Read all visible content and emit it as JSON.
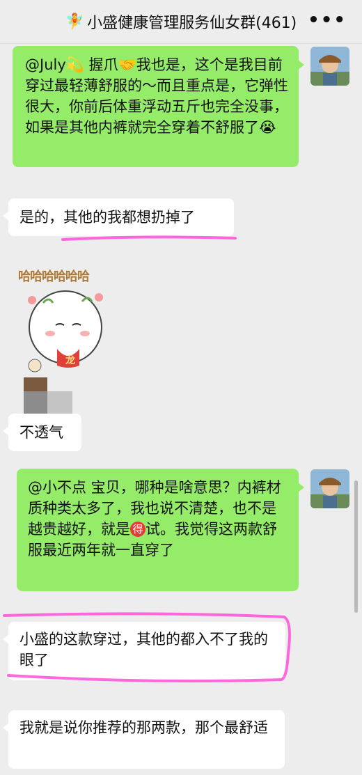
{
  "header": {
    "title": "小盛健康管理服务仙女群(461)",
    "fairy_icon": "fairy-emoji-icon",
    "more_label": "•••"
  },
  "messages": [
    {
      "side": "right",
      "mention": "@July",
      "text_a": " 握爪",
      "text_b": "我也是，这个是我目前穿过最轻薄舒服的～而且重点是，它弹性很大，你前后体重浮动五斤也完全没事，如果是其他内裤就完全穿着不舒服了"
    },
    {
      "side": "left",
      "text": "是的，其他的我都想扔掉了"
    },
    {
      "side": "left",
      "sticker_caption": "哈哈哈哈哈哈",
      "sticker_badge": "龙"
    },
    {
      "side": "left",
      "text": "不透气"
    },
    {
      "side": "right",
      "text_a": "@小不点 宝贝，哪种是啥意思？内裤材质种类太多了，我也说不清楚，也不是越贵越好，就是",
      "circle": "得",
      "text_b": "试。我觉得这两款舒服最近两年就一直穿了"
    },
    {
      "side": "left",
      "text": "小盛的这款穿过，其他的都入不了我的眼了"
    },
    {
      "side": "left",
      "text": "我就是说你推荐的那两款，那个最舒适"
    }
  ],
  "colors": {
    "self_bubble": "#95ec69",
    "other_bubble": "#ffffff",
    "highlight": "#ff4fd8"
  }
}
